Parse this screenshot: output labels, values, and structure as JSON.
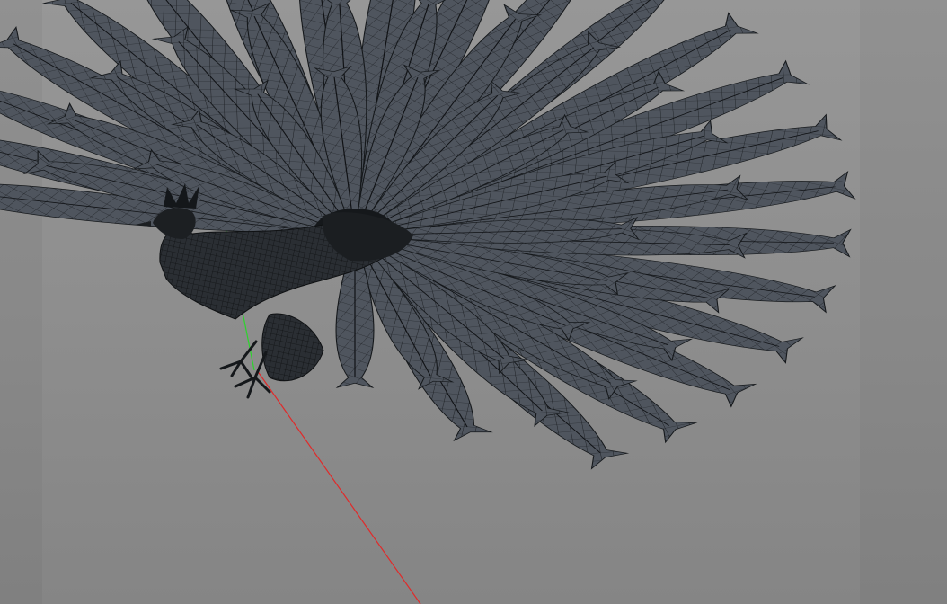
{
  "viewport": {
    "background_color": "#8f8f8f",
    "axis_colors": {
      "x": "#e02a2a",
      "y": "#2bd42b"
    }
  },
  "model": {
    "type": "peacock-wireframe",
    "fill_color": "#4d535c",
    "wire_color": "#171a1e",
    "body_color": "#1e2125"
  }
}
